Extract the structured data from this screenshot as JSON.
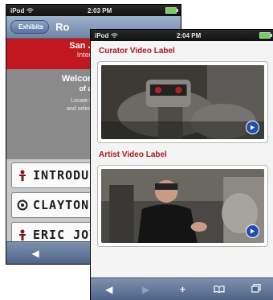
{
  "back_screen": {
    "status": {
      "carrier": "iPod",
      "time": "2:03 PM"
    },
    "nav": {
      "back_label": "Exhibits",
      "title": "Ro"
    },
    "banner": {
      "museum_name": "San Jose M",
      "subtitle": "Interactive"
    },
    "welcome": {
      "title_line1": "Welcome to Ro",
      "title_line2": "of a Cult",
      "body_line1": "Locate the special",
      "body_line2": "and select the artist fr"
    },
    "artists": [
      {
        "name": "INTRODU",
        "icon": "figure-icon"
      },
      {
        "name": "CLAYTON",
        "icon": "spiral-icon"
      },
      {
        "name": "ERIC JOY",
        "icon": "figure-icon"
      }
    ],
    "toolbar": {
      "back_glyph": "◀",
      "forward_glyph": "▶",
      "add_glyph": "+"
    }
  },
  "front_screen": {
    "status": {
      "carrier": "iPod",
      "time": "2:04 PM"
    },
    "videos": [
      {
        "label": "Curator Video Label",
        "thumb": "robot"
      },
      {
        "label": "Artist Video Label",
        "thumb": "artist"
      }
    ],
    "toolbar": {
      "back_glyph": "◀",
      "forward_glyph": "▶",
      "add_glyph": "+",
      "bookmarks_glyph": "📖",
      "tabs_glyph": "⧉"
    }
  },
  "colors": {
    "accent_red": "#c0181e",
    "label_red": "#a51a20",
    "nav_blue": "#6e86a8",
    "play_blue": "#1f4fb0"
  }
}
